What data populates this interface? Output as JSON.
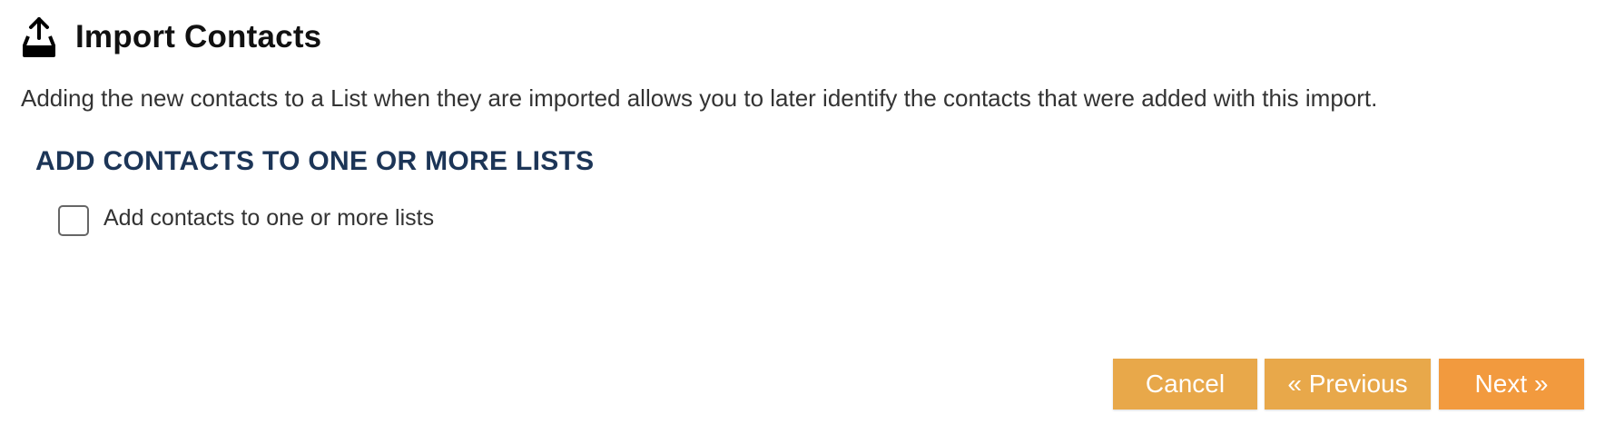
{
  "header": {
    "title": "Import Contacts",
    "icon": "upload-tray-icon"
  },
  "description": "Adding the new contacts to a List when they are imported allows you to later identify the contacts that were added with this import.",
  "section": {
    "heading": "ADD CONTACTS TO ONE OR MORE LISTS",
    "checkbox_label": "Add contacts to one or more lists",
    "checkbox_checked": false
  },
  "buttons": {
    "cancel": "Cancel",
    "previous": "« Previous",
    "next": "Next »"
  },
  "colors": {
    "heading": "#1c3557",
    "button_secondary": "#e8a84a",
    "button_primary": "#f29a3e"
  }
}
